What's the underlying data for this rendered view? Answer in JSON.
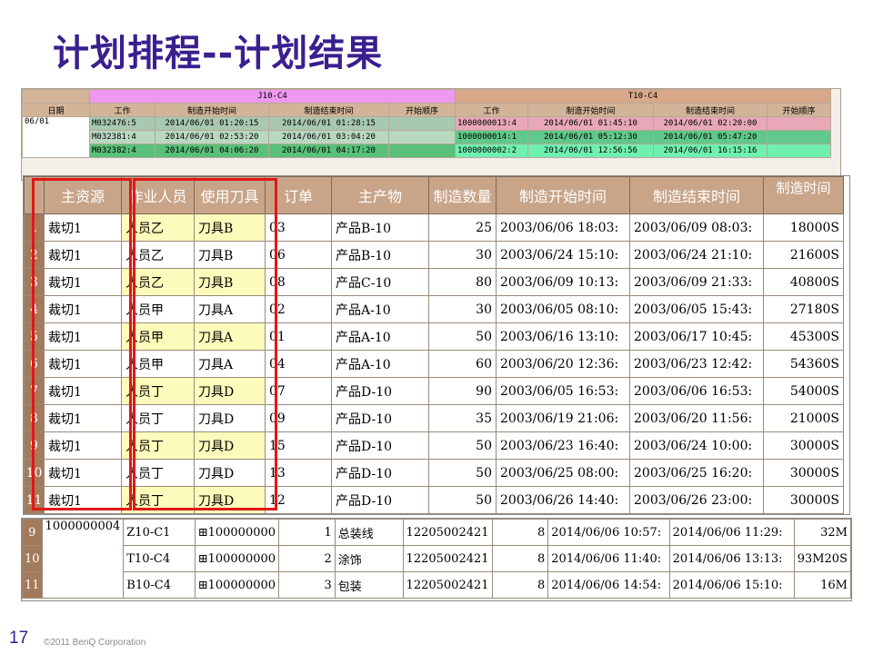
{
  "slide": {
    "title": "计划排程--计划结果",
    "page_number": "17",
    "copyright": "©2011 BenQ Corporation"
  },
  "back_grid": {
    "group_j": "J10-C4",
    "group_t": "T10-C4",
    "date_header": "日期",
    "cols": [
      "工作",
      "制造开始时间",
      "制造结束时间",
      "开始顺序",
      "工作",
      "制造开始时间",
      "制造结束时间",
      "开始顺序"
    ],
    "date_value": "06/01",
    "rows": [
      {
        "job1": "M032476:5",
        "start1": "2014/06/01 01:20:15",
        "end1": "2014/06/01 01:28:15",
        "job2": "1000000013:4",
        "start2": "2014/06/01 01:45:10",
        "end2": "2014/06/01 02:20:00"
      },
      {
        "job1": "M032381:4",
        "start1": "2014/06/01 02:53:20",
        "end1": "2014/06/01 03:04:20",
        "job2": "1000000014:1",
        "start2": "2014/06/01 05:12:30",
        "end2": "2014/06/01 05:47:20"
      },
      {
        "job1": "M032382:4",
        "start1": "2014/06/01 04:06:20",
        "end1": "2014/06/01 04:17:20",
        "job2": "1000000002:2",
        "start2": "2014/06/01 12:56:56",
        "end2": "2014/06/01 16:15:16"
      }
    ]
  },
  "main_grid": {
    "headers": [
      "主资源",
      "作业人员",
      "使用刀具",
      "订单",
      "主产物",
      "制造数量",
      "制造开始时间",
      "制造结束时间",
      "制造时间"
    ],
    "rows": [
      {
        "n": "1",
        "res": "裁切1",
        "person": "人员乙",
        "tool": "刀具B",
        "order": "03",
        "product": "产品B-10",
        "qty": "25",
        "start": "2003/06/06 18:03:",
        "end": "2003/06/09 08:03:",
        "time": "18000S",
        "hl": true
      },
      {
        "n": "2",
        "res": "裁切1",
        "person": "人员乙",
        "tool": "刀具B",
        "order": "06",
        "product": "产品B-10",
        "qty": "30",
        "start": "2003/06/24 15:10:",
        "end": "2003/06/24 21:10:",
        "time": "21600S",
        "hl": false
      },
      {
        "n": "3",
        "res": "裁切1",
        "person": "人员乙",
        "tool": "刀具B",
        "order": "08",
        "product": "产品C-10",
        "qty": "80",
        "start": "2003/06/09 10:13:",
        "end": "2003/06/09 21:33:",
        "time": "40800S",
        "hl": true
      },
      {
        "n": "4",
        "res": "裁切1",
        "person": "人员甲",
        "tool": "刀具A",
        "order": "02",
        "product": "产品A-10",
        "qty": "30",
        "start": "2003/06/05 08:10:",
        "end": "2003/06/05 15:43:",
        "time": "27180S",
        "hl": false
      },
      {
        "n": "5",
        "res": "裁切1",
        "person": "人员甲",
        "tool": "刀具A",
        "order": "01",
        "product": "产品A-10",
        "qty": "50",
        "start": "2003/06/16 13:10:",
        "end": "2003/06/17 10:45:",
        "time": "45300S",
        "hl": true
      },
      {
        "n": "6",
        "res": "裁切1",
        "person": "人员甲",
        "tool": "刀具A",
        "order": "04",
        "product": "产品A-10",
        "qty": "60",
        "start": "2003/06/20 12:36:",
        "end": "2003/06/23 12:42:",
        "time": "54360S",
        "hl": false
      },
      {
        "n": "7",
        "res": "裁切1",
        "person": "人员丁",
        "tool": "刀具D",
        "order": "07",
        "product": "产品D-10",
        "qty": "90",
        "start": "2003/06/05 16:53:",
        "end": "2003/06/06 16:53:",
        "time": "54000S",
        "hl": true
      },
      {
        "n": "8",
        "res": "裁切1",
        "person": "人员丁",
        "tool": "刀具D",
        "order": "09",
        "product": "产品D-10",
        "qty": "35",
        "start": "2003/06/19 21:06:",
        "end": "2003/06/20 11:56:",
        "time": "21000S",
        "hl": false
      },
      {
        "n": "9",
        "res": "裁切1",
        "person": "人员丁",
        "tool": "刀具D",
        "order": "15",
        "product": "产品D-10",
        "qty": "50",
        "start": "2003/06/23 16:40:",
        "end": "2003/06/24 10:00:",
        "time": "30000S",
        "hl": true
      },
      {
        "n": "10",
        "res": "裁切1",
        "person": "人员丁",
        "tool": "刀具D",
        "order": "13",
        "product": "产品D-10",
        "qty": "50",
        "start": "2003/06/25 08:00:",
        "end": "2003/06/25 16:20:",
        "time": "30000S",
        "hl": false
      },
      {
        "n": "11",
        "res": "裁切1",
        "person": "人员丁",
        "tool": "刀具D",
        "order": "12",
        "product": "产品D-10",
        "qty": "50",
        "start": "2003/06/26 14:40:",
        "end": "2003/06/26 23:00:",
        "time": "30000S",
        "hl": true
      }
    ]
  },
  "bottom_grid": {
    "job": "1000000004",
    "rows": [
      {
        "n": "9",
        "machine": "Z10-C1",
        "item": "⊞100000000",
        "seq": "1",
        "proc": "总装线",
        "code": "12205002421",
        "qty": "8",
        "start": "2014/06/06 10:57:",
        "end": "2014/06/06 11:29:",
        "dur": "32M"
      },
      {
        "n": "10",
        "machine": "T10-C4",
        "item": "⊞100000000",
        "seq": "2",
        "proc": "涂饰",
        "code": "12205002421",
        "qty": "8",
        "start": "2014/06/06 11:40:",
        "end": "2014/06/06 13:13:",
        "dur": "93M20S"
      },
      {
        "n": "11",
        "machine": "B10-C4",
        "item": "⊞100000000",
        "seq": "3",
        "proc": "包装",
        "code": "12205002421",
        "qty": "8",
        "start": "2014/06/06 14:54:",
        "end": "2014/06/06 15:10:",
        "dur": "16M"
      }
    ]
  }
}
